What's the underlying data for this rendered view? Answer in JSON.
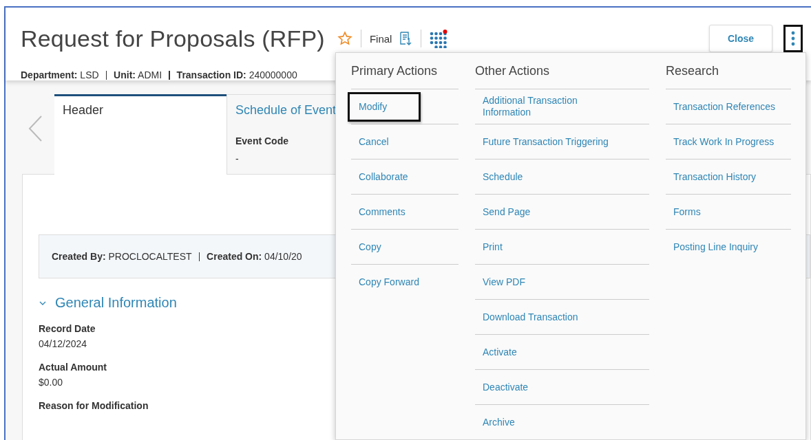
{
  "title": "Request for Proposals (RFP)",
  "favorite": false,
  "status": "Final",
  "notifications": true,
  "meta": [
    {
      "label": "Department:",
      "value": "LSD"
    },
    {
      "label": "Unit:",
      "value": "ADMI"
    },
    {
      "label": "Transaction ID:",
      "value": "240000000"
    }
  ],
  "close_button": "Close",
  "more_button": {
    "highlighted": true
  },
  "tabs": [
    {
      "label": "Header",
      "selected": true
    },
    {
      "label": "Schedule of Event",
      "selected": false,
      "fields": [
        {
          "label": "Event Code",
          "value": "-"
        }
      ]
    }
  ],
  "created": [
    {
      "label": "Created By:",
      "value": "PROCLOCALTEST"
    },
    {
      "label": "Created On:",
      "value": "04/10/20"
    }
  ],
  "section": {
    "title": "General Information",
    "expanded": true,
    "fields": [
      {
        "label": "Record Date",
        "value": "04/12/2024"
      },
      {
        "label": "Actual Amount",
        "value": "$0.00"
      },
      {
        "label": "Reason for Modification"
      }
    ]
  },
  "menu": {
    "columns": [
      {
        "title": "Primary Actions",
        "items": [
          {
            "label": "Modify",
            "highlighted": true
          },
          {
            "label": "Cancel",
            "highlighted": false
          },
          {
            "label": "Collaborate",
            "highlighted": false
          },
          {
            "label": "Comments",
            "highlighted": false
          },
          {
            "label": "Copy",
            "highlighted": false
          },
          {
            "label": "Copy Forward",
            "highlighted": false
          }
        ]
      },
      {
        "title": "Other Actions",
        "items": [
          {
            "label": "Additional Transaction Information",
            "highlighted": false
          },
          {
            "label": "Future Transaction Triggering",
            "highlighted": false
          },
          {
            "label": "Schedule",
            "highlighted": false
          },
          {
            "label": "Send Page",
            "highlighted": false
          },
          {
            "label": "Print",
            "highlighted": false
          },
          {
            "label": "View PDF",
            "highlighted": false
          },
          {
            "label": "Download Transaction",
            "highlighted": false
          },
          {
            "label": "Activate",
            "highlighted": false
          },
          {
            "label": "Deactivate",
            "highlighted": false
          },
          {
            "label": "Archive",
            "highlighted": false
          }
        ]
      },
      {
        "title": "Research",
        "items": [
          {
            "label": "Transaction References",
            "highlighted": false
          },
          {
            "label": "Track Work In Progress",
            "highlighted": false
          },
          {
            "label": "Transaction History",
            "highlighted": false
          },
          {
            "label": "Forms",
            "highlighted": false
          },
          {
            "label": "Posting Line Inquiry",
            "highlighted": false
          }
        ]
      }
    ]
  }
}
